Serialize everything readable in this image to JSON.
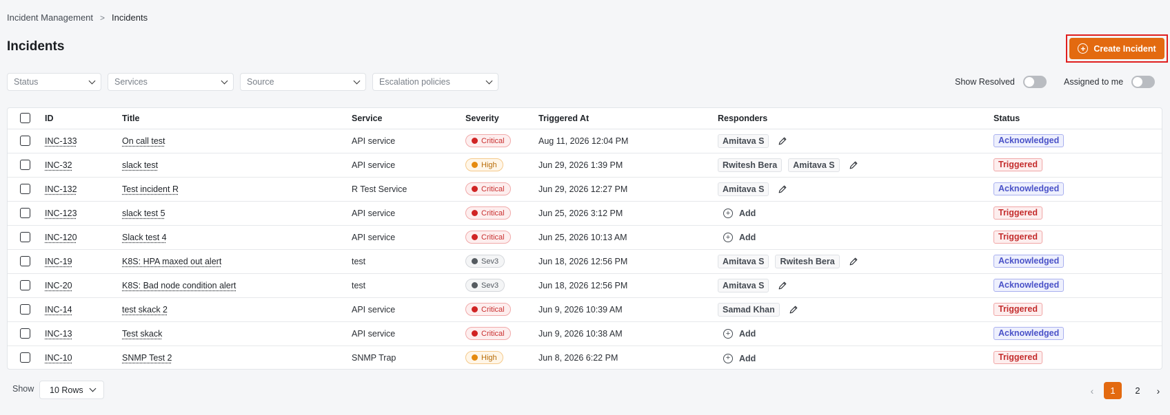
{
  "breadcrumb": {
    "parent": "Incident Management",
    "separator": ">",
    "current": "Incidents"
  },
  "page": {
    "title": "Incidents",
    "create_button": "Create Incident"
  },
  "filters": [
    {
      "placeholder": "Status"
    },
    {
      "placeholder": "Services"
    },
    {
      "placeholder": "Source"
    },
    {
      "placeholder": "Escalation policies"
    }
  ],
  "toggles": {
    "show_resolved": "Show Resolved",
    "show_resolved_on": false,
    "assigned_to_me": "Assigned to me",
    "assigned_to_me_on": false
  },
  "table": {
    "columns": [
      "ID",
      "Title",
      "Service",
      "Severity",
      "Triggered At",
      "Responders",
      "Status"
    ],
    "add_label": "Add",
    "rows": [
      {
        "id": "INC-133",
        "title": "On call test",
        "service": "API service",
        "severity": "Critical",
        "triggered": "Aug 11, 2026 12:04 PM",
        "responders": [
          "Amitava S"
        ],
        "status": "Acknowledged"
      },
      {
        "id": "INC-32",
        "title": "slack test",
        "service": "API service",
        "severity": "High",
        "triggered": "Jun 29, 2026 1:39 PM",
        "responders": [
          "Rwitesh Bera",
          "Amitava S"
        ],
        "status": "Triggered"
      },
      {
        "id": "INC-132",
        "title": "Test incident R",
        "service": "R Test Service",
        "severity": "Critical",
        "triggered": "Jun 29, 2026 12:27 PM",
        "responders": [
          "Amitava S"
        ],
        "status": "Acknowledged"
      },
      {
        "id": "INC-123",
        "title": "slack test 5",
        "service": "API service",
        "severity": "Critical",
        "triggered": "Jun 25, 2026 3:12 PM",
        "responders": [],
        "status": "Triggered"
      },
      {
        "id": "INC-120",
        "title": "Slack test 4",
        "service": "API service",
        "severity": "Critical",
        "triggered": "Jun 25, 2026 10:13 AM",
        "responders": [],
        "status": "Triggered"
      },
      {
        "id": "INC-19",
        "title": "K8S: HPA maxed out alert",
        "service": "test",
        "severity": "Sev3",
        "triggered": "Jun 18, 2026 12:56 PM",
        "responders": [
          "Amitava S",
          "Rwitesh Bera"
        ],
        "status": "Acknowledged"
      },
      {
        "id": "INC-20",
        "title": "K8S: Bad node condition alert",
        "service": "test",
        "severity": "Sev3",
        "triggered": "Jun 18, 2026 12:56 PM",
        "responders": [
          "Amitava S"
        ],
        "status": "Acknowledged"
      },
      {
        "id": "INC-14",
        "title": "test skack 2",
        "service": "API service",
        "severity": "Critical",
        "triggered": "Jun 9, 2026 10:39 AM",
        "responders": [
          "Samad Khan"
        ],
        "status": "Triggered"
      },
      {
        "id": "INC-13",
        "title": "Test skack",
        "service": "API service",
        "severity": "Critical",
        "triggered": "Jun 9, 2026 10:38 AM",
        "responders": [],
        "status": "Acknowledged"
      },
      {
        "id": "INC-10",
        "title": "SNMP Test 2",
        "service": "SNMP Trap",
        "severity": "High",
        "triggered": "Jun 8, 2026 6:22 PM",
        "responders": [],
        "status": "Triggered"
      }
    ]
  },
  "footer": {
    "show_label": "Show",
    "rows_value": "10 Rows",
    "pages": [
      "1",
      "2"
    ],
    "current_page": "1",
    "prev_icon": "‹",
    "next_icon": "›"
  },
  "colors": {
    "accent": "#e36a10",
    "highlight_border": "#e01e1e"
  }
}
